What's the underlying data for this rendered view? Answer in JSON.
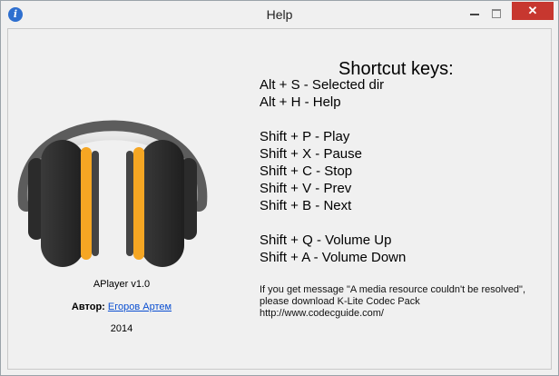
{
  "window": {
    "title": "Help",
    "icon": "info-icon",
    "controls": {
      "close_glyph": "✕"
    }
  },
  "about": {
    "version": "APlayer v1.0",
    "author_label": "Автор:",
    "author_link": "Егоров Артем",
    "year": "2014"
  },
  "shortcuts": {
    "title": "Shortcut keys:",
    "groups": [
      [
        "Alt + S - Selected dir",
        "Alt + H - Help"
      ],
      [
        "Shift + P - Play",
        "Shift + X - Pause",
        "Shift + C - Stop",
        "Shift + V - Prev",
        "Shift + B - Next"
      ],
      [
        "Shift + Q - Volume Up",
        "Shift + A - Volume Down"
      ]
    ]
  },
  "message": {
    "line1": "If you get message \"A media resource couldn't be resolved\",",
    "line2": "please download K-Lite Codec Pack",
    "line3": "http://www.codecguide.com/"
  },
  "colors": {
    "accent_orange": "#f5a623",
    "close_red": "#c7372f",
    "link_blue": "#0b4fd1"
  }
}
